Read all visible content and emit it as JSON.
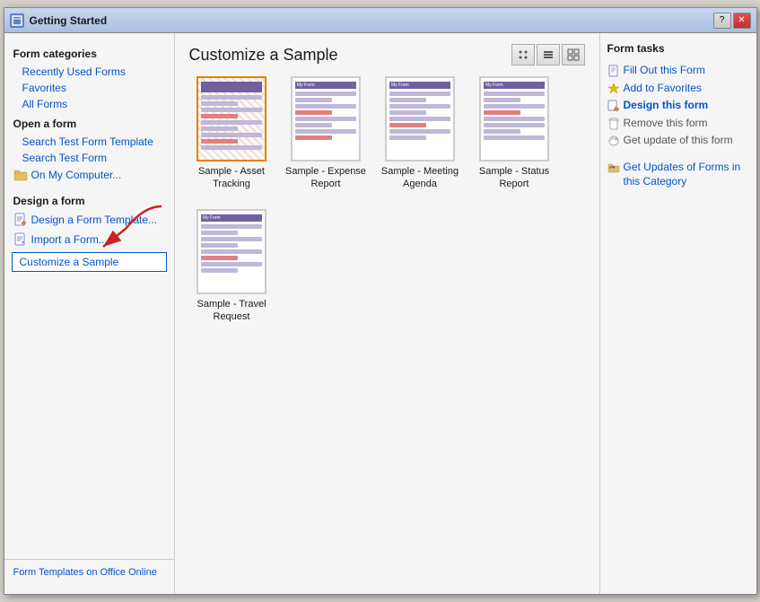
{
  "window": {
    "title": "Getting Started",
    "close_btn": "✕",
    "help_btn": "?"
  },
  "sidebar": {
    "form_categories_title": "Form categories",
    "recently_used_forms": "Recently Used Forms",
    "favorites": "Favorites",
    "all_forms": "All Forms",
    "open_a_form_title": "Open a form",
    "search_test_form_template": "Search Test Form Template",
    "search_test_form": "Search Test Form",
    "on_my_computer": "On My Computer...",
    "design_a_form_title": "Design a form",
    "design_a_form_template": "Design a Form Template...",
    "import_a_form": "Import a Form...",
    "customize_a_sample": "Customize a Sample",
    "bottom_link": "Form Templates on Office Online"
  },
  "main": {
    "title": "Customize a Sample",
    "forms": [
      {
        "id": "asset-tracking",
        "label": "Sample - Asset Tracking",
        "selected": true
      },
      {
        "id": "expense-report",
        "label": "Sample - Expense Report",
        "selected": false
      },
      {
        "id": "meeting-agenda",
        "label": "Sample - Meeting Agenda",
        "selected": false
      },
      {
        "id": "status-report",
        "label": "Sample - Status Report",
        "selected": false
      },
      {
        "id": "travel-request",
        "label": "Sample - Travel Request",
        "selected": false
      }
    ]
  },
  "right_panel": {
    "title": "Form tasks",
    "tasks": [
      {
        "id": "fill-out",
        "label": "Fill Out this Form",
        "active": false,
        "disabled": false
      },
      {
        "id": "add-favorites",
        "label": "Add to Favorites",
        "active": false,
        "disabled": false
      },
      {
        "id": "design",
        "label": "Design this form",
        "active": true,
        "disabled": false
      },
      {
        "id": "remove",
        "label": "Remove this form",
        "active": false,
        "disabled": false
      },
      {
        "id": "get-update",
        "label": "Get update of this form",
        "active": false,
        "disabled": false
      },
      {
        "id": "get-updates-category",
        "label": "Get Updates of Forms in this Category",
        "active": false,
        "disabled": false
      }
    ]
  },
  "view_buttons": [
    "⊞",
    "☰",
    "▦"
  ]
}
